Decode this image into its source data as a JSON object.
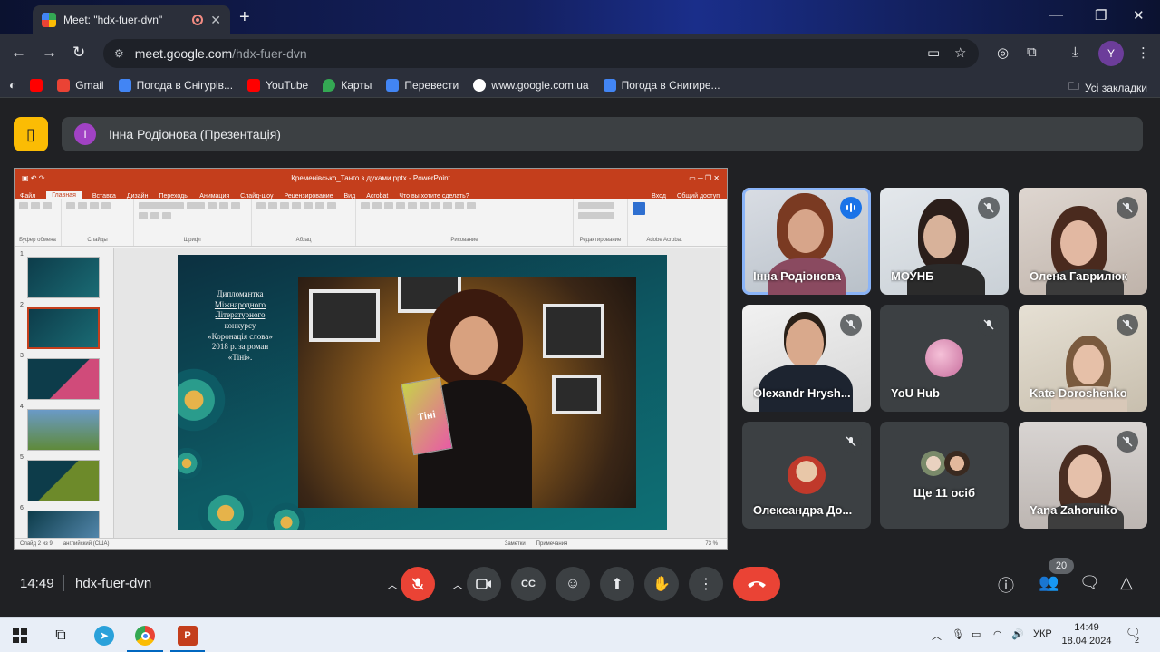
{
  "browser": {
    "tab_title": "Meet: \"hdx-fuer-dvn\"",
    "url_host": "meet.google.com",
    "url_path": "/hdx-fuer-dvn",
    "profile_initial": "Y",
    "bookmarks": [
      {
        "label": "Gmail",
        "color": "#ea4335"
      },
      {
        "label": "Погода в Снігурів...",
        "color": "#4285f4"
      },
      {
        "label": "YouTube",
        "color": "#ff0000"
      },
      {
        "label": "Карты",
        "color": "#34a853"
      },
      {
        "label": "Перевести",
        "color": "#4285f4"
      },
      {
        "label": "www.google.com.ua",
        "color": "#ffffff"
      },
      {
        "label": "Погода в Снигире...",
        "color": "#4285f4"
      }
    ],
    "all_bookmarks": "Усі закладки"
  },
  "meet": {
    "presenter_initial": "І",
    "presenter_label": "Інна Родіонова (Презентація)",
    "time": "14:49",
    "meeting_code": "hdx-fuer-dvn",
    "participant_count": "20",
    "participants": [
      {
        "name": "Інна Родіонова",
        "speaking": true,
        "muted": false
      },
      {
        "name": "МОУНБ",
        "speaking": false,
        "muted": true
      },
      {
        "name": "Олена Гаврилюк",
        "speaking": false,
        "muted": true
      },
      {
        "name": "Olexandr Hrysh...",
        "speaking": false,
        "muted": true
      },
      {
        "name": "YoU Hub",
        "speaking": false,
        "muted": true
      },
      {
        "name": "Kate Doroshenko",
        "speaking": false,
        "muted": true
      },
      {
        "name": "Олександра До...",
        "speaking": false,
        "muted": true
      },
      {
        "name": "Ще 11 осіб",
        "speaking": false,
        "muted": false
      },
      {
        "name": "Yana Zahoruiko",
        "speaking": false,
        "muted": true
      }
    ]
  },
  "ppt": {
    "window_title": "Кременівсько_Танго з духами.pptx - PowerPoint",
    "tabs": [
      "Файл",
      "Главная",
      "Вставка",
      "Дизайн",
      "Переходы",
      "Анимация",
      "Слайд-шоу",
      "Рецензирование",
      "Вид",
      "Acrobat",
      "Что вы хотите сделать?"
    ],
    "right_tabs": [
      "Вход",
      "Общий доступ"
    ],
    "groups": [
      "Буфер обмена",
      "Слайды",
      "Шрифт",
      "Абзац",
      "Рисование",
      "Редактирование",
      "Adobe Acrobat"
    ],
    "slide_text_lines": [
      "Дипломантка",
      "Міжнародного",
      "Літературного",
      "конкурсу",
      "«Коронація слова»",
      "2018 р. за роман",
      "«Тіні»."
    ],
    "book_title": "Тіні",
    "thumb_numbers": [
      "1",
      "2",
      "3",
      "4",
      "5",
      "6"
    ],
    "status_left": "Слайд 2 из 9",
    "status_lang": "английский (США)",
    "status_notes": "Заметки",
    "status_comments": "Примечания",
    "zoom": "73 %"
  },
  "taskbar": {
    "lang": "УКР",
    "time": "14:49",
    "date": "18.04.2024",
    "notif_count": "2"
  }
}
